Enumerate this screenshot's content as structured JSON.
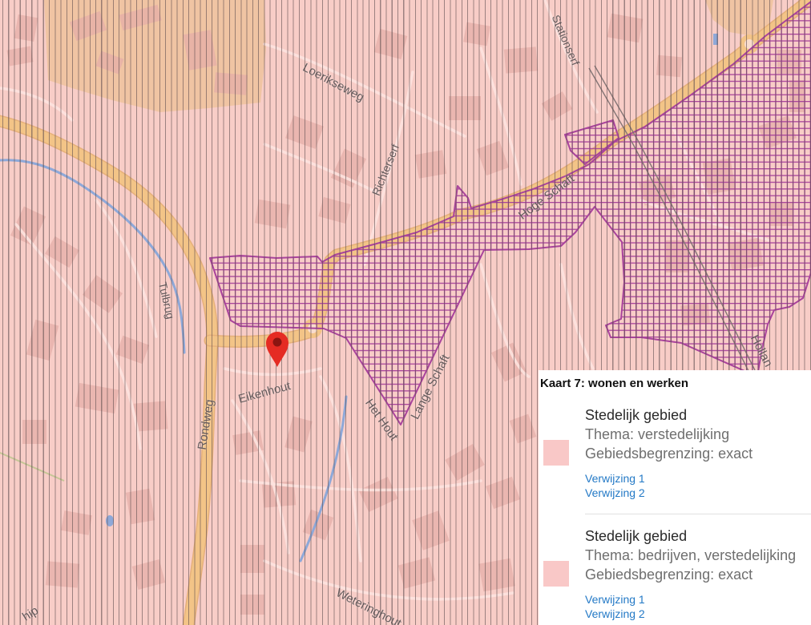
{
  "map": {
    "colors": {
      "base": "#f8cdc7",
      "road": "#f3c487",
      "area": "#efc29c",
      "water": "#8ea8d8",
      "hatch": "#a9439c",
      "marker": "#e52b23"
    },
    "street_labels": [
      "Stationserf",
      "Loerikseweg",
      "Richterserf",
      "Hoge Schaft",
      "Tulbrug",
      "Eikenhout",
      "Rondweg",
      "Het Hout",
      "Lange Schaft",
      "Hollan",
      "Weteringhout",
      "hip"
    ],
    "marker_icon": "map-pin-icon"
  },
  "legend": {
    "title": "Kaart 7: wonen en werken",
    "items": [
      {
        "title": "Stedelijk gebied",
        "theme": "Thema: verstedelijking",
        "boundary": "Gebiedsbegrenzing: exact",
        "swatch_color": "#f9c8c7",
        "links": [
          "Verwijzing 1",
          "Verwijzing 2"
        ]
      },
      {
        "title": "Stedelijk gebied",
        "theme": "Thema: bedrijven, verstedelijking",
        "boundary": "Gebiedsbegrenzing: exact",
        "swatch_color": "#f9c8c7",
        "links": [
          "Verwijzing 1",
          "Verwijzing 2"
        ]
      }
    ]
  }
}
